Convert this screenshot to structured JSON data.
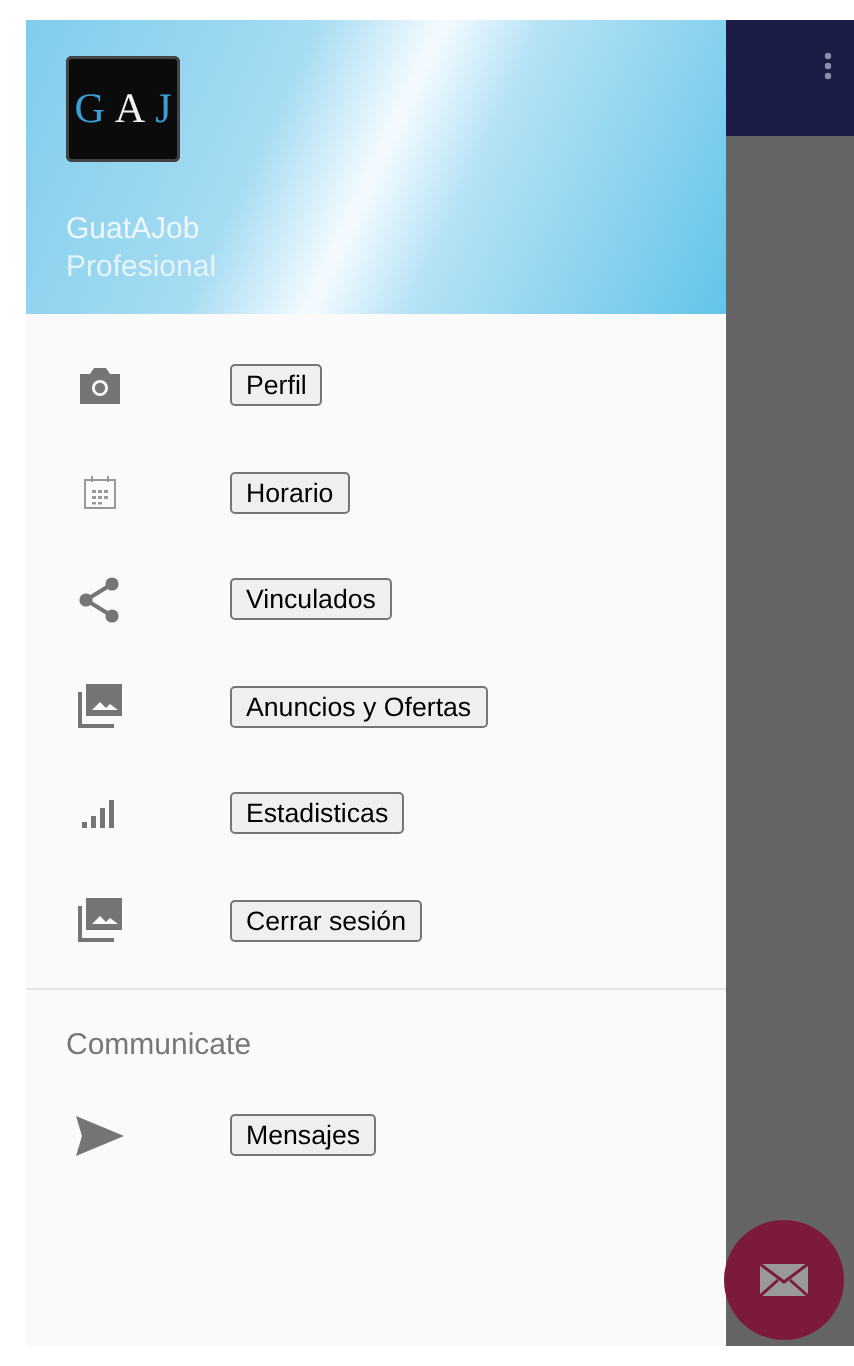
{
  "drawer": {
    "header": {
      "logo": {
        "letters": [
          "G",
          "A",
          "J"
        ]
      },
      "title": "GuatAJob",
      "subtitle": "Profesional"
    },
    "items": [
      {
        "label": "Perfil"
      },
      {
        "label": "Horario"
      },
      {
        "label": "Vinculados"
      },
      {
        "label": "Anuncios y Ofertas"
      },
      {
        "label": "Estadisticas"
      },
      {
        "label": "Cerrar sesión"
      }
    ],
    "sections": [
      {
        "title": "Communicate",
        "items": [
          {
            "label": "Mensajes"
          }
        ]
      }
    ]
  }
}
